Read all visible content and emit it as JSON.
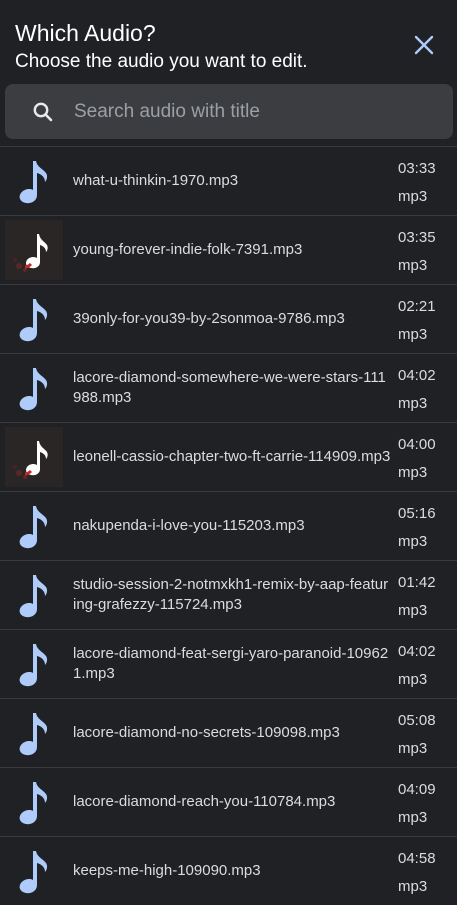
{
  "header": {
    "title": "Which Audio?",
    "subtitle": "Choose the audio you want to edit."
  },
  "search": {
    "placeholder": "Search audio with title",
    "value": ""
  },
  "icons": {
    "close": "close-icon",
    "search": "search-icon",
    "note": "music-note-icon",
    "album_art": "album-art-icon"
  },
  "colors": {
    "background": "#202124",
    "note": "#aecbfa",
    "search_bg": "#3c3d40"
  },
  "audio_list": [
    {
      "title": "what-u-thinkin-1970.mp3",
      "duration": "03:33",
      "ext": "mp3",
      "thumb": "note"
    },
    {
      "title": "young-forever-indie-folk-7391.mp3",
      "duration": "03:35",
      "ext": "mp3",
      "thumb": "art"
    },
    {
      "title": "39only-for-you39-by-2sonmoa-9786.mp3",
      "duration": "02:21",
      "ext": "mp3",
      "thumb": "note"
    },
    {
      "title": "lacore-diamond-somewhere-we-were-stars-111988.mp3",
      "duration": "04:02",
      "ext": "mp3",
      "thumb": "note"
    },
    {
      "title": "leonell-cassio-chapter-two-ft-carrie-114909.mp3",
      "duration": "04:00",
      "ext": "mp3",
      "thumb": "art"
    },
    {
      "title": "nakupenda-i-love-you-115203.mp3",
      "duration": "05:16",
      "ext": "mp3",
      "thumb": "note"
    },
    {
      "title": "studio-session-2-notmxkh1-remix-by-aap-featuring-grafezzy-115724.mp3",
      "duration": "01:42",
      "ext": "mp3",
      "thumb": "note"
    },
    {
      "title": "lacore-diamond-feat-sergi-yaro-paranoid-109621.mp3",
      "duration": "04:02",
      "ext": "mp3",
      "thumb": "note"
    },
    {
      "title": "lacore-diamond-no-secrets-109098.mp3",
      "duration": "05:08",
      "ext": "mp3",
      "thumb": "note"
    },
    {
      "title": "lacore-diamond-reach-you-110784.mp3",
      "duration": "04:09",
      "ext": "mp3",
      "thumb": "note"
    },
    {
      "title": "keeps-me-high-109090.mp3",
      "duration": "04:58",
      "ext": "mp3",
      "thumb": "note"
    }
  ]
}
